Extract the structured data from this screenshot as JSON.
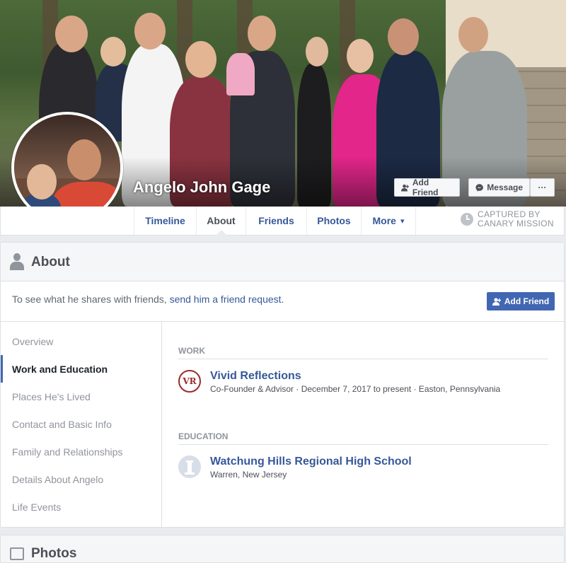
{
  "profile": {
    "name": "Angelo John Gage",
    "cover_buttons": {
      "add_friend": "Add Friend",
      "message": "Message",
      "more": "···"
    }
  },
  "nav": {
    "tabs": [
      {
        "label": "Timeline",
        "active": false
      },
      {
        "label": "About",
        "active": true
      },
      {
        "label": "Friends",
        "active": false
      },
      {
        "label": "Photos",
        "active": false
      },
      {
        "label": "More",
        "active": false
      }
    ],
    "more_caret": "▾",
    "captured_line1": "CAPTURED BY",
    "captured_line2": "CANARY MISSION"
  },
  "about": {
    "title": "About",
    "friend_prompt": "To see what he shares with friends,",
    "friend_link": "send him a friend request.",
    "add_friend_button": "Add Friend",
    "sidebar": [
      {
        "label": "Overview",
        "active": false
      },
      {
        "label": "Work and Education",
        "active": true
      },
      {
        "label": "Places He's Lived",
        "active": false
      },
      {
        "label": "Contact and Basic Info",
        "active": false
      },
      {
        "label": "Family and Relationships",
        "active": false
      },
      {
        "label": "Details About Angelo",
        "active": false
      },
      {
        "label": "Life Events",
        "active": false
      }
    ],
    "work": {
      "heading": "WORK",
      "logo_text": "VR",
      "employer": "Vivid Reflections",
      "details": "Co-Founder & Advisor · December 7, 2017 to present · Easton, Pennsylvania"
    },
    "education": {
      "heading": "EDUCATION",
      "school": "Watchung Hills Regional High School",
      "location": "Warren, New Jersey"
    }
  },
  "photos": {
    "title": "Photos"
  },
  "colors": {
    "link": "#365899",
    "primary_button": "#4267b2",
    "page_bg": "#e9ebee",
    "vr_logo": "#9b2b2b"
  }
}
